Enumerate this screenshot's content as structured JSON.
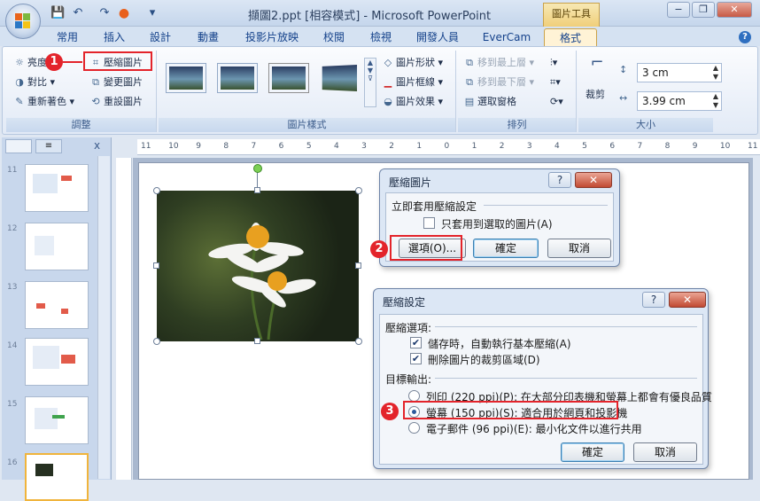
{
  "window": {
    "title": "擷圖2.ppt [相容模式] - Microsoft PowerPoint",
    "context_tab": "圖片工具",
    "minimize": "−",
    "restore": "❐",
    "close": "✕"
  },
  "quick_access": {
    "save": "💾",
    "undo": "↶",
    "redo": "↷",
    "customize": "▾"
  },
  "tabs": [
    "常用",
    "插入",
    "設計",
    "動畫",
    "投影片放映",
    "校閱",
    "檢視",
    "開發人員",
    "EverCam",
    "格式"
  ],
  "help": "?",
  "ribbon": {
    "adjust": {
      "label": "調整",
      "brightness": "亮度",
      "contrast": "對比",
      "recolor": "重新著色",
      "compress": "壓縮圖片",
      "change": "變更圖片",
      "reset": "重設圖片"
    },
    "styles": {
      "label": "圖片樣式",
      "shape": "圖片形狀",
      "border": "圖片框線",
      "effects": "圖片效果"
    },
    "arrange": {
      "label": "排列",
      "bring_front": "移到最上層",
      "send_back": "移到最下層",
      "selection_pane": "選取窗格"
    },
    "size": {
      "label": "大小",
      "crop": "裁剪",
      "height": "3 cm",
      "width": "3.99 cm"
    }
  },
  "ruler": {
    "h_ticks": [
      "11",
      "10",
      "9",
      "8",
      "7",
      "6",
      "5",
      "4",
      "3",
      "2",
      "1",
      "0",
      "1",
      "2",
      "3",
      "4",
      "5",
      "6",
      "7",
      "8",
      "9",
      "10",
      "11"
    ]
  },
  "slides_pane": {
    "numbers": [
      "11",
      "12",
      "13",
      "14",
      "15",
      "16"
    ],
    "close": "x"
  },
  "dialog_compress": {
    "title": "壓縮圖片",
    "help": "?",
    "close": "✕",
    "group_label": "立即套用壓縮設定",
    "only_selected": "只套用到選取的圖片(A)",
    "only_selected_checked": false,
    "options_button": "選項(O)...",
    "ok": "確定",
    "cancel": "取消"
  },
  "dialog_settings": {
    "title": "壓縮設定",
    "help": "?",
    "close": "✕",
    "compress_options_label": "壓縮選項:",
    "auto_compress": "儲存時，自動執行基本壓縮(A)",
    "auto_compress_checked": true,
    "delete_cropped": "刪除圖片的裁剪區域(D)",
    "delete_cropped_checked": true,
    "target_label": "目標輸出:",
    "print": "列印 (220 ppi)(P): 在大部分印表機和螢幕上都會有優良品質",
    "screen": "螢幕 (150 ppi)(S): 適合用於網頁和投影機",
    "email": "電子郵件 (96 ppi)(E): 最小化文件以進行共用",
    "selected": "screen",
    "ok": "確定",
    "cancel": "取消"
  },
  "markers": [
    "1",
    "2",
    "3"
  ],
  "colors": {
    "accent_red": "#e3242b",
    "ribbon_blue": "#15428b"
  }
}
